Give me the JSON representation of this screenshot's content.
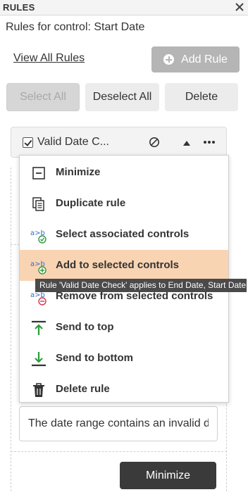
{
  "panel": {
    "title": "RULES",
    "close_glyph": "×"
  },
  "rules_for": "Rules for control: Start Date",
  "view_all": "View All Rules",
  "add_rule": "Add Rule",
  "buttons": {
    "select_all": "Select All",
    "deselect_all": "Deselect All",
    "delete": "Delete"
  },
  "rule": {
    "name": "Valid Date C...",
    "checked": true
  },
  "menu": {
    "items": [
      {
        "label": "Minimize",
        "icon": "minimize-icon"
      },
      {
        "label": "Duplicate rule",
        "icon": "duplicate-icon"
      },
      {
        "label": "Select associated controls",
        "icon": "select-associated-icon"
      },
      {
        "label": "Add to selected controls",
        "icon": "add-to-selected-icon"
      },
      {
        "label": "Remove from selected controls",
        "icon": "remove-from-selected-icon"
      },
      {
        "label": "Send to top",
        "icon": "send-to-top-icon"
      },
      {
        "label": "Send to bottom",
        "icon": "send-to-bottom-icon"
      },
      {
        "label": "Delete rule",
        "icon": "trash-icon"
      }
    ],
    "highlighted_item": "Add to selected controls"
  },
  "tooltip": "Rule 'Valid Date Check' applies to End Date, Start Date",
  "message_field": {
    "value": "The date range contains an invalid date"
  },
  "minimize_button": "Minimize",
  "colors": {
    "highlight": "#f9d4b3",
    "green_accent": "#2e9a3e",
    "red_accent": "#d2334a",
    "blue_accent": "#2f6fc8",
    "dark_button": "#3a3a3a"
  }
}
